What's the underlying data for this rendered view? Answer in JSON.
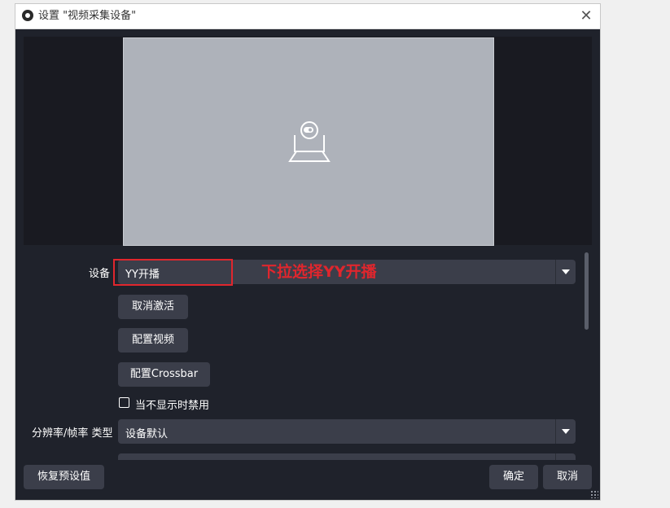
{
  "window": {
    "title": "设置 \"视频采集设备\"",
    "close_symbol": "✕"
  },
  "preview": {
    "icon": "webcam-placeholder-icon"
  },
  "form": {
    "device_label": "设备",
    "device_value": "YY开播",
    "annotation": "下拉选择YY开播",
    "deactivate_button": "取消激活",
    "configure_video_button": "配置视频",
    "configure_crossbar_button": "配置Crossbar",
    "disable_when_hidden_label": "当不显示时禁用",
    "disable_when_hidden_checked": false,
    "resolution_label": "分辨率/帧率 类型",
    "resolution_value": "设备默认"
  },
  "footer": {
    "restore_defaults_button": "恢复预设值",
    "ok_button": "确定",
    "cancel_button": "取消"
  },
  "colors": {
    "annotation_red": "#e0262d",
    "dialog_background": "#1f222b",
    "control_background": "#3b3e4a",
    "preview_background": "#aeb2ba"
  }
}
